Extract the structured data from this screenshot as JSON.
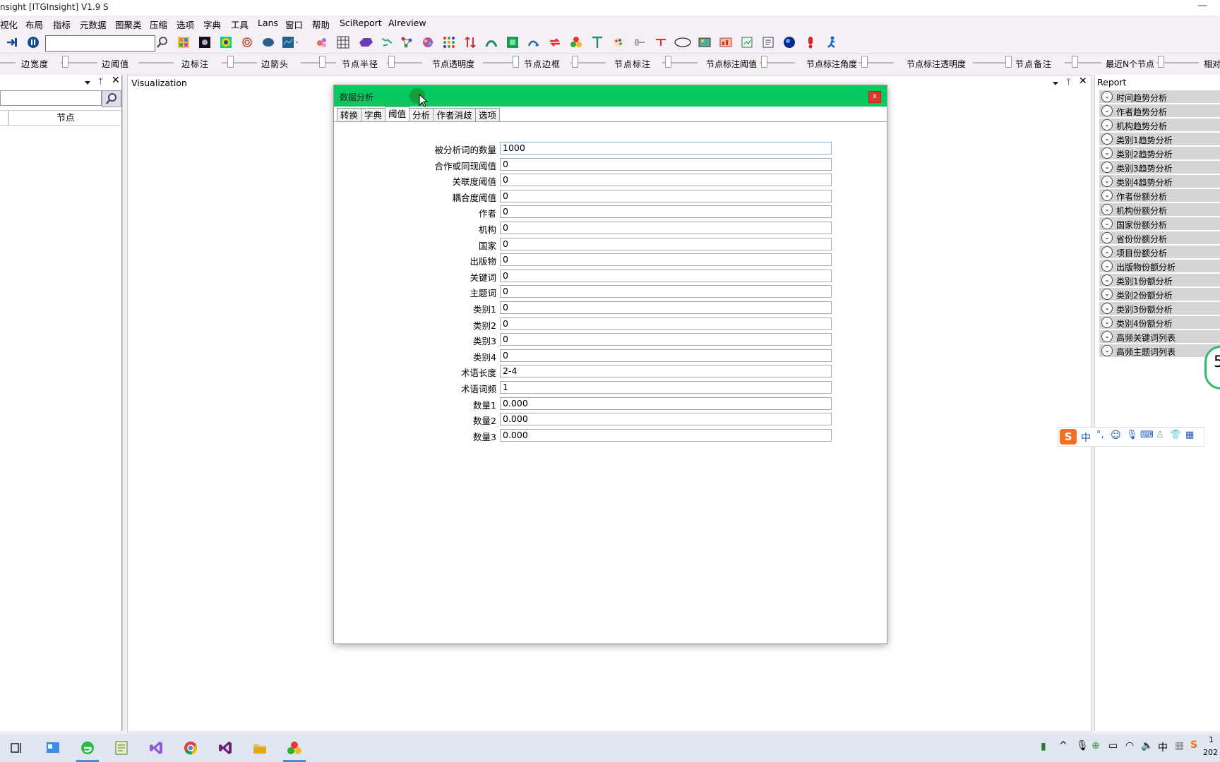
{
  "window": {
    "title": "nsight [ITGInsight] V1.9 S"
  },
  "menu": [
    "视化",
    "布局",
    "指标",
    "元数据",
    "图聚类",
    "压缩",
    "选项",
    "字典",
    "工具",
    "Lans",
    "窗口",
    "帮助",
    "SciReport",
    "AIreview"
  ],
  "toolbar": {
    "search_value": ""
  },
  "sliders": [
    "边宽度",
    "边阈值",
    "边标注",
    "边箭头",
    "节点半径",
    "节点透明度",
    "节点边框",
    "节点标注",
    "节点标注阈值",
    "节点标注角度",
    "节点标注透明度",
    "节点备注",
    "最近N个节点",
    "相对"
  ],
  "left_pane": {
    "column_header": "节点"
  },
  "vis_pane": {
    "title": "Visualization"
  },
  "dialog": {
    "title": "数据分析",
    "close_label": "x",
    "tabs": [
      "转换",
      "字典",
      "阈值",
      "分析",
      "作者消歧",
      "选项"
    ],
    "active_tab": "阈值",
    "fields": [
      {
        "label": "被分析词的数量",
        "value": "1000"
      },
      {
        "label": "合作或同现阈值",
        "value": "0"
      },
      {
        "label": "关联度阈值",
        "value": "0"
      },
      {
        "label": "耦合度阈值",
        "value": "0"
      },
      {
        "label": "作者",
        "value": "0"
      },
      {
        "label": "机构",
        "value": "0"
      },
      {
        "label": "国家",
        "value": "0"
      },
      {
        "label": "出版物",
        "value": "0"
      },
      {
        "label": "关键词",
        "value": "0"
      },
      {
        "label": "主题词",
        "value": "0"
      },
      {
        "label": "类别1",
        "value": "0"
      },
      {
        "label": "类别2",
        "value": "0"
      },
      {
        "label": "类别3",
        "value": "0"
      },
      {
        "label": "类别4",
        "value": "0"
      },
      {
        "label": "术语长度",
        "value": "2-4"
      },
      {
        "label": "术语词频",
        "value": "1"
      },
      {
        "label": "数量1",
        "value": "0.000"
      },
      {
        "label": "数量2",
        "value": "0.000"
      },
      {
        "label": "数量3",
        "value": "0.000"
      }
    ]
  },
  "report_pane": {
    "title": "Report",
    "items": [
      "时间趋势分析",
      "作者趋势分析",
      "机构趋势分析",
      "类别1趋势分析",
      "类别2趋势分析",
      "类别3趋势分析",
      "类别4趋势分析",
      "作者份额分析",
      "机构份额分析",
      "国家份额分析",
      "省份份额分析",
      "项目份额分析",
      "出版物份额分析",
      "类别1份额分析",
      "类别2份额分析",
      "类别3份额分析",
      "类别4份额分析",
      "高频关键词列表",
      "高频主题词列表"
    ],
    "badge_text": "5"
  },
  "ime": {
    "mode_label": "中"
  },
  "taskbar": {
    "clock_time": "1",
    "clock_date": "202"
  },
  "colors": {
    "dialog_title": "#08c95f",
    "report_item": "#d4d4d4",
    "close_button": "#e0372c"
  }
}
